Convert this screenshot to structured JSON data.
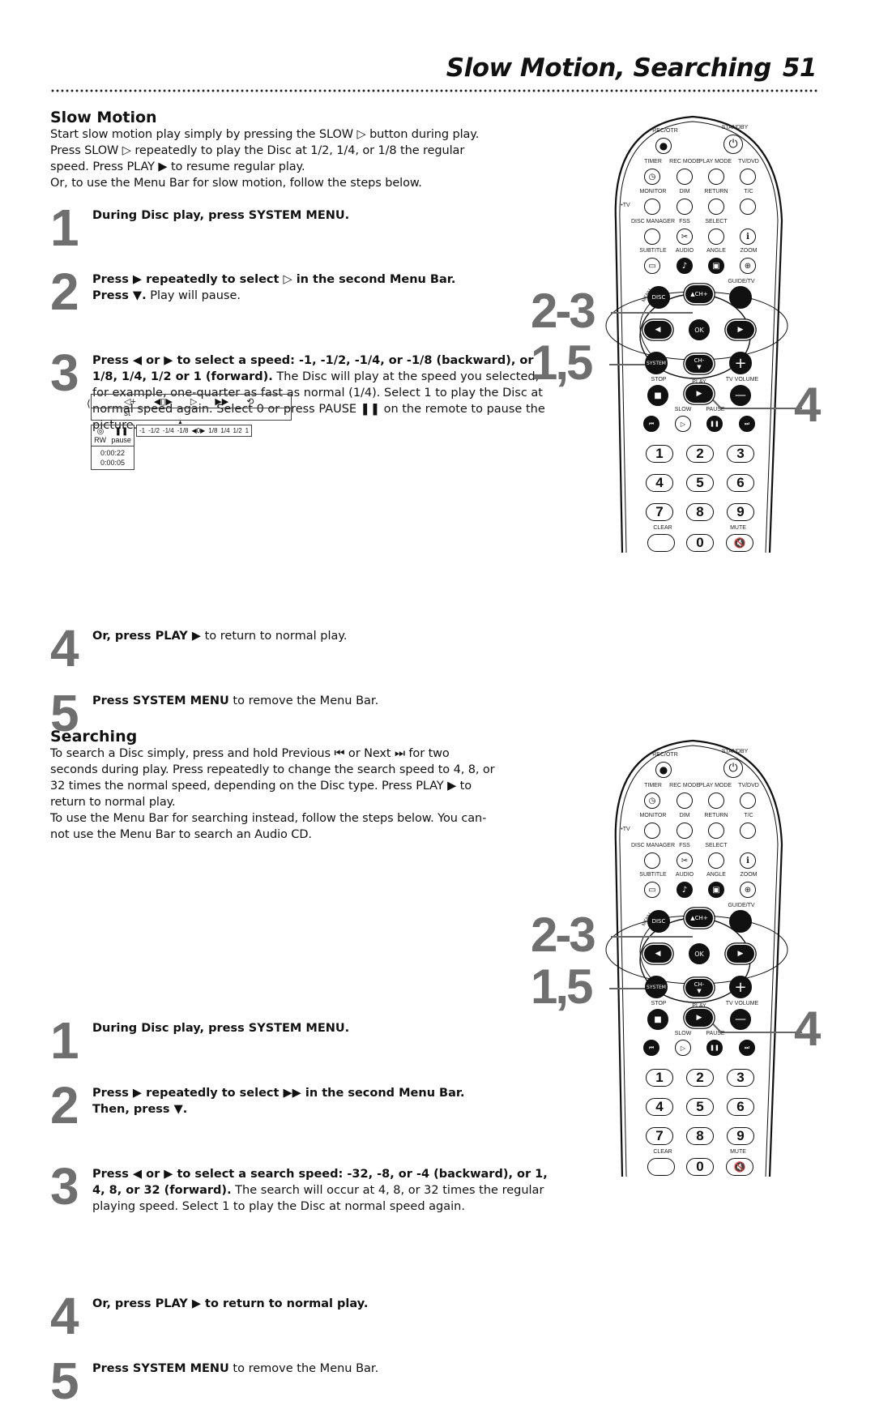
{
  "header": {
    "title": "Slow Motion, Searching",
    "page_number": "51"
  },
  "slow_motion": {
    "heading": "Slow Motion",
    "intro": [
      "Start slow motion play simply by pressing the SLOW ▷ button during play.",
      "Press SLOW ▷ repeatedly to play the Disc at 1/2, 1/4, or 1/8 the regular",
      "speed. Press PLAY ▶ to resume regular play.",
      "Or, to use the Menu Bar for slow motion, follow the steps below."
    ],
    "steps": [
      {
        "num": "1",
        "bold": "During Disc play, press SYSTEM MENU.",
        "rest": ""
      },
      {
        "num": "2",
        "bold": "Press ▶ repeatedly to select ▷ in the second Menu Bar.",
        "bold2": "Press ▼.",
        "rest": " Play will pause."
      },
      {
        "num": "3",
        "bold": "Press ◀ or ▶ to select a speed: -1, -1/2, -1/4, or -1/8 (backward), or 1/8, 1/4, 1/2 or 1 (forward).",
        "rest": " The Disc will play at the speed you selected, for example, one-quarter as fast as normal (1/4). Select 1 to play the Disc at normal speed again. Select 0 or press PAUSE ❚❚ on the remote to pause the picture."
      },
      {
        "num": "4",
        "bold": "Or, press PLAY ▶",
        "rest": " to return to normal play."
      },
      {
        "num": "5",
        "bold": "Press SYSTEM MENU",
        "rest": " to remove the Menu Bar."
      }
    ],
    "menu_bar": {
      "row1_icons": [
        "⟨",
        "◁+",
        "◀▯▶",
        "▷",
        "▶▶",
        "⟲"
      ],
      "row2_text": "st",
      "status_icons": [
        "◎",
        "❚❚"
      ],
      "status_labels": [
        "RW",
        "pause"
      ],
      "times": [
        "0:00:22",
        "0:00:05"
      ],
      "speeds": [
        "-1",
        "-1/2",
        "-1/4",
        "-1/8",
        "◀0▶",
        "1/8",
        "1/4",
        "1/2",
        "1"
      ]
    }
  },
  "searching": {
    "heading": "Searching",
    "intro": [
      "To search a Disc simply, press and hold Previous ⏮ or Next ⏭ for two",
      "seconds during play. Press repeatedly to change the search speed to 4, 8, or",
      "32 times the normal speed, depending on the Disc type. Press PLAY ▶ to",
      "return to normal play.",
      "To use the Menu Bar for searching instead, follow the steps below. You can-",
      "not use the Menu Bar to search an Audio CD."
    ],
    "steps": [
      {
        "num": "1",
        "bold": "During Disc play, press SYSTEM MENU.",
        "rest": ""
      },
      {
        "num": "2",
        "bold": "Press ▶ repeatedly to select ▶▶ in the second Menu Bar.",
        "bold2": "Then, press ▼.",
        "rest": ""
      },
      {
        "num": "3",
        "bold": "Press ◀ or ▶ to select a search speed: -32, -8, or -4 (backward), or 1, 4, 8, or 32 (forward).",
        "rest": " The search will occur at 4, 8, or 32 times the regular playing speed. Select 1 to play the Disc at normal speed again."
      },
      {
        "num": "4",
        "bold": "Or, press PLAY ▶ to return to normal play.",
        "rest": ""
      },
      {
        "num": "5",
        "bold": "Press SYSTEM MENU",
        "rest": " to remove the Menu Bar."
      }
    ]
  },
  "remote": {
    "callouts": [
      "2-3",
      "1,5",
      "4"
    ],
    "labels": {
      "rec_otr": "REC/OTR",
      "standby": "STANDBY",
      "timer": "TIMER",
      "rec_mode": "REC MODE",
      "play_mode": "PLAY MODE",
      "tv_dvd": "TV/DVD",
      "monitor": "MONITOR",
      "dim": "DIM",
      "return": "RETURN",
      "tc": "T/C",
      "tv": "•TV",
      "disc_manager": "DISC MANAGER",
      "fss": "FSS",
      "select": "SELECT",
      "subtitle": "SUBTITLE",
      "audio": "AUDIO",
      "angle": "ANGLE",
      "zoom": "ZOOM",
      "guide_tv": "GUIDE/TV",
      "disc": "DISC",
      "ch_plus": "CH+",
      "ok": "OK",
      "system": "SYSTEM",
      "ch_minus": "CH-",
      "menu": "MENU",
      "stop": "STOP",
      "play": "PLAY",
      "tv_volume": "TV VOLUME",
      "slow": "SLOW",
      "pause": "PAUSE",
      "clear": "CLEAR",
      "mute": "MUTE"
    },
    "digits": [
      "1",
      "2",
      "3",
      "4",
      "5",
      "6",
      "7",
      "8",
      "9",
      "0"
    ]
  }
}
